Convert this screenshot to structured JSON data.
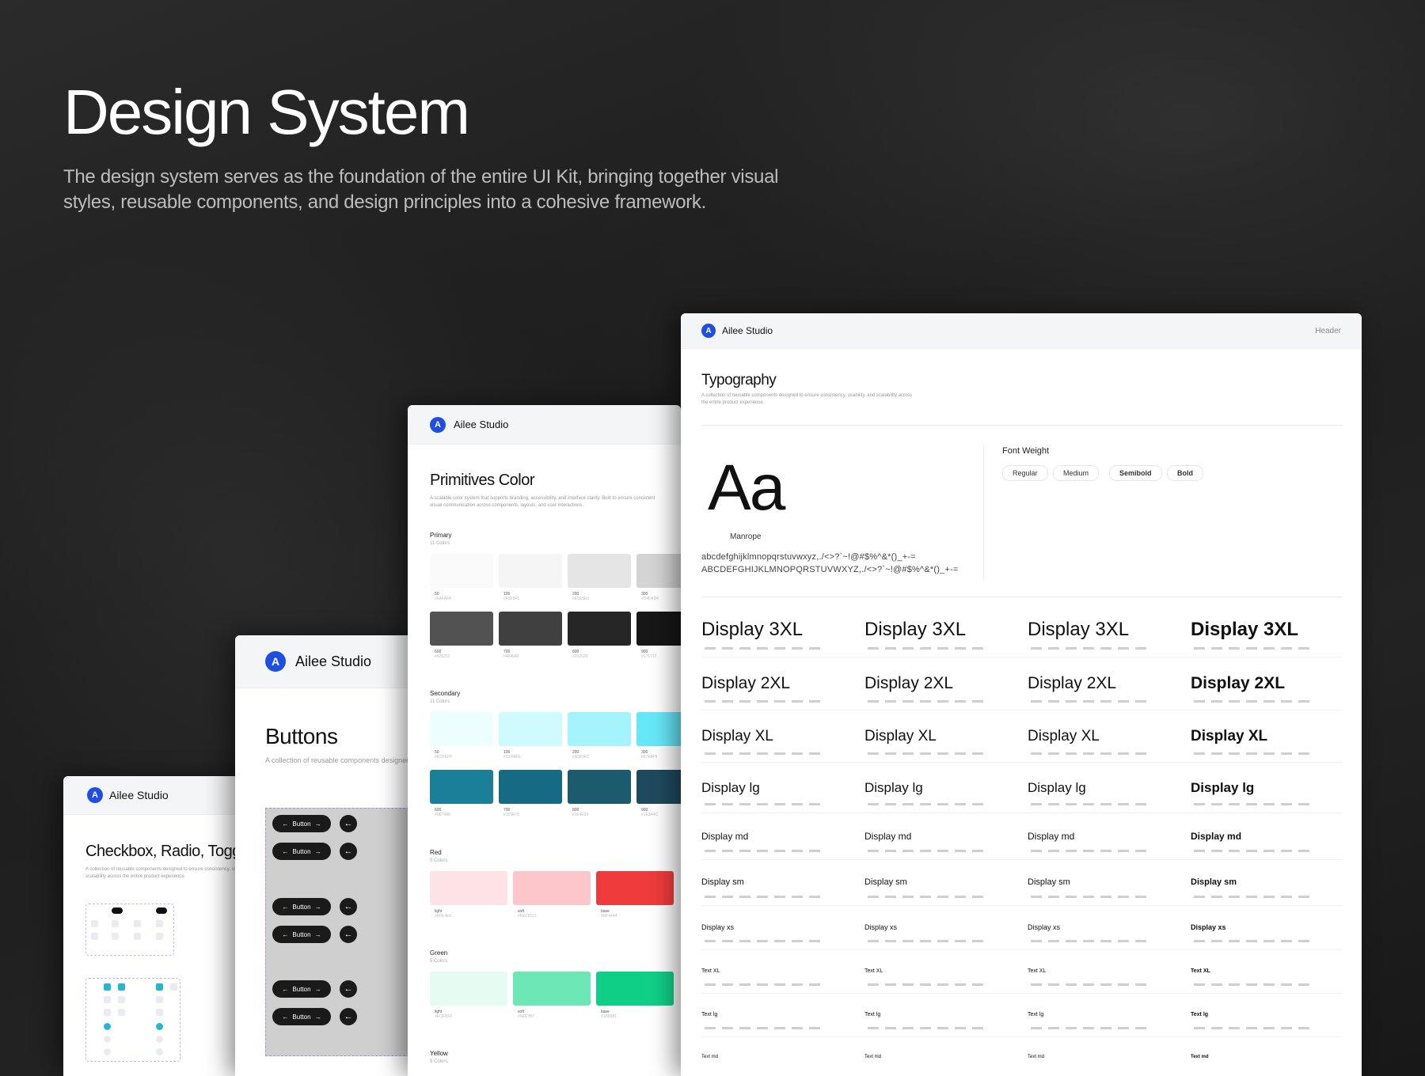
{
  "hero": {
    "title": "Design System",
    "description": "The design system serves as the foundation of the entire UI Kit, bringing together visual styles, reusable components, and design principles into a cohesive framework."
  },
  "brand": {
    "name": "Ailee Studio",
    "logo_icon": "ailee-logo-icon",
    "accent": "#1f4fe0"
  },
  "checkbox_card": {
    "title": "Checkbox, Radio, Toggle",
    "description": "A collection of reusable components designed to ensure consistency, usability, and scalability across the entire product experience."
  },
  "buttons_card": {
    "title": "Buttons",
    "description": "A collection of reusable components designed to ensure consistency, usability, and scalability across the entire product experience.",
    "button_label": "Button"
  },
  "color_card": {
    "title": "Primitives Color",
    "description": "A scalable color system that supports branding, accessibility, and interface clarity. Built to ensure consistent visual communication across components, layouts, and user interactions.",
    "palettes": [
      {
        "name": "Primary",
        "count": "11 Colors",
        "row1": [
          {
            "step": "50",
            "hex": "#FAFAFA",
            "color": "#fafafa"
          },
          {
            "step": "100",
            "hex": "#F5F5F5",
            "color": "#f5f5f5"
          },
          {
            "step": "200",
            "hex": "#E5E5E5",
            "color": "#e5e5e5"
          },
          {
            "step": "300",
            "hex": "#D4D4D4",
            "color": "#d4d4d4"
          }
        ],
        "row2": [
          {
            "step": "600",
            "hex": "#525252",
            "color": "#525252"
          },
          {
            "step": "700",
            "hex": "#404040",
            "color": "#404040"
          },
          {
            "step": "800",
            "hex": "#262626",
            "color": "#262626"
          },
          {
            "step": "900",
            "hex": "#171717",
            "color": "#171717"
          }
        ]
      },
      {
        "name": "Secondary",
        "count": "11 Colors",
        "row1": [
          {
            "step": "50",
            "hex": "#ECFEFF",
            "color": "#ecfeff"
          },
          {
            "step": "100",
            "hex": "#CFFAFE",
            "color": "#cffafe"
          },
          {
            "step": "200",
            "hex": "#A5F3FC",
            "color": "#a5f3fc"
          },
          {
            "step": "300",
            "hex": "#67E8F9",
            "color": "#67e8f9"
          }
        ],
        "row2": [
          {
            "step": "600",
            "hex": "#0E7490",
            "color": "#1a7f99"
          },
          {
            "step": "700",
            "hex": "#155E75",
            "color": "#166a84"
          },
          {
            "step": "800",
            "hex": "#164E63",
            "color": "#1c5b6e"
          },
          {
            "step": "900",
            "hex": "#1E3A4C",
            "color": "#1f4a5e"
          }
        ]
      },
      {
        "name": "Red",
        "count": "5 Colors",
        "row1": [
          {
            "step": "light",
            "hex": "#FFE4E6",
            "color": "#fde3e6"
          },
          {
            "step": "soft",
            "hex": "#FECDD3",
            "color": "#fdc6cb"
          },
          {
            "step": "base",
            "hex": "#EF4444",
            "color": "#ef3b3b"
          }
        ]
      },
      {
        "name": "Green",
        "count": "5 Colors",
        "row1": [
          {
            "step": "light",
            "hex": "#ECFDF5",
            "color": "#e6fbf1"
          },
          {
            "step": "soft",
            "hex": "#6EE7B7",
            "color": "#6ee7b7"
          },
          {
            "step": "base",
            "hex": "#10B981",
            "color": "#0fcf87"
          }
        ]
      },
      {
        "name": "Yellow",
        "count": "5 Colors",
        "row1": []
      }
    ]
  },
  "typography_card": {
    "header_right": "Header",
    "title": "Typography",
    "description": "A collection of reusable components designed to ensure consistency, usability, and scalability across the entire product experience.",
    "sample": "Aa",
    "font_name": "Manrope",
    "charset_lower": "abcdefghijklmnopqrstuvwxyz,./<>?`~!@#$%^&*()_+-=",
    "charset_upper": "ABCDEFGHIJKLMNOPQRSTUVWXYZ,./<>?`~!@#$%^&*()_+-=",
    "font_weight_title": "Font Weight",
    "weights": [
      "Regular",
      "Medium",
      "Semibold",
      "Bold"
    ],
    "scales": [
      "Display 3XL",
      "Display 2XL",
      "Display XL",
      "Display lg",
      "Display md",
      "Display sm",
      "Display xs",
      "Text XL",
      "Text lg",
      "Text md"
    ]
  }
}
